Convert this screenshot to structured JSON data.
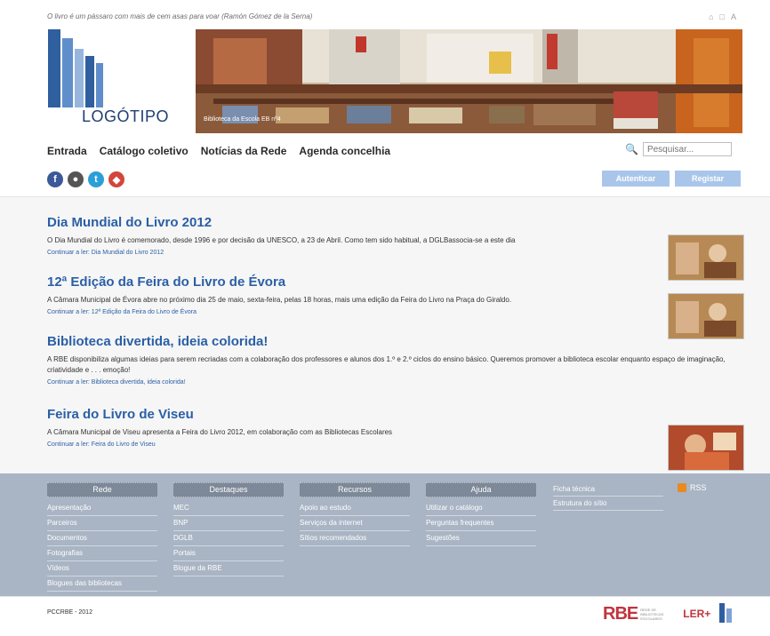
{
  "header": {
    "quote": "O livro é um pássaro com mais de cem asas para voar (Ramón Gómez de la Serna)",
    "logo_text": "LOGÓTIPO",
    "banner_caption": "Biblioteca da Escola EB nº4",
    "top_icons": [
      "⌂",
      "□",
      "A"
    ]
  },
  "nav": {
    "items": [
      "Entrada",
      "Catálogo coletivo",
      "Notícias da Rede",
      "Agenda concelhia"
    ],
    "search_placeholder": "Pesquisar..."
  },
  "social": {
    "icons": [
      {
        "name": "facebook-icon",
        "glyph": "f",
        "color": "#3b5998"
      },
      {
        "name": "delicious-icon",
        "glyph": "●",
        "color": "#555555"
      },
      {
        "name": "twitter-icon",
        "glyph": "t",
        "color": "#2b9fd8"
      },
      {
        "name": "other-social-icon",
        "glyph": "◆",
        "color": "#d2463c"
      }
    ]
  },
  "auth": {
    "login": "Autenticar",
    "register": "Registar"
  },
  "articles": [
    {
      "title": "Dia Mundial do Livro 2012",
      "body": "O Dia Mundial do Livro é comemorado, desde 1996 e por decisão da UNESCO, a 23 de Abril. Como tem sido habitual, a DGLBassocia-se a este dia",
      "more": "Continuar a ler: Dia Mundial do Livro 2012"
    },
    {
      "title": "12ª Edição da Feira do Livro de Évora",
      "body": "A Câmara Municipal de Évora abre no próximo dia 25 de maio, sexta-feira, pelas 18 horas, mais uma edição da Feira do Livro na Praça do Giraldo.",
      "more": "Continuar a ler: 12ª Edição da Feira do Livro de Évora"
    },
    {
      "title": "Biblioteca divertida, ideia colorida!",
      "body": "A RBE disponibiliza algumas ideias para serem recriadas com a colaboração dos professores e alunos dos 1.º e 2.º ciclos do ensino básico. Queremos promover a biblioteca escolar enquanto espaço de imaginação, criatividade e . . . emoção!",
      "more": "Continuar a ler: Biblioteca divertida, ideia colorida!"
    },
    {
      "title": "Feira do Livro de Viseu",
      "body": "A Câmara Municipal de Viseu apresenta a Feira do Livro 2012, em colaboração com as Bibliotecas Escolares",
      "more": "Continuar a ler: Feira do Livro de Viseu"
    }
  ],
  "footer": {
    "columns": [
      {
        "head": "Rede",
        "items": [
          "Apresentação",
          "Parceiros",
          "Documentos",
          "Fotografias",
          "Vídeos",
          "Blogues das bibliotecas"
        ]
      },
      {
        "head": "Destaques",
        "items": [
          "MEC",
          "BNP",
          "DGLB",
          "Portais",
          "Blogue da RBE"
        ]
      },
      {
        "head": "Recursos",
        "items": [
          "Apoio ao estudo",
          "Serviços da internet",
          "Sítios recomendados"
        ]
      },
      {
        "head": "Ajuda",
        "items": [
          "Utilizar o catálogo",
          "Perguntas frequentes",
          "Sugestões"
        ]
      }
    ],
    "extra": [
      "Ficha técnica",
      "Estrutura do sítio"
    ],
    "rss": "RSS",
    "copyright": "PCCRBE - 2012",
    "partners": {
      "rbe": "RBE",
      "rbe_sub": "REDE DE BIBLIOTECAS ESCOLARES",
      "ler": "LER+"
    }
  }
}
